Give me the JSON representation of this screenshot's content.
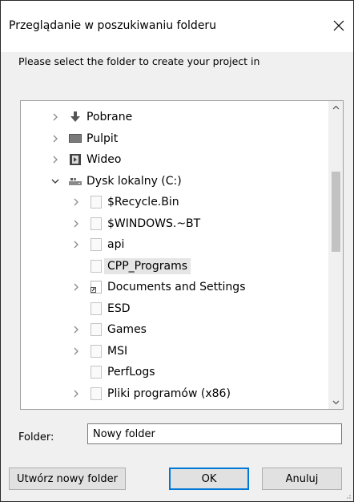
{
  "window": {
    "title": "Przeglądanie w poszukiwaniu folderu",
    "close_icon": "close-icon"
  },
  "instruction": "Please select the folder to create your project in",
  "tree": {
    "items": [
      {
        "label": "Pobrane",
        "icon": "download-arrow-icon",
        "expander": "collapsed",
        "level": 1
      },
      {
        "label": "Pulpit",
        "icon": "desktop-icon",
        "expander": "collapsed",
        "level": 1
      },
      {
        "label": "Wideo",
        "icon": "video-icon",
        "expander": "collapsed",
        "level": 1
      },
      {
        "label": "Dysk lokalny (C:)",
        "icon": "drive-icon",
        "expander": "expanded",
        "level": 1
      },
      {
        "label": "$Recycle.Bin",
        "icon": "folder-icon",
        "expander": "collapsed",
        "level": 2
      },
      {
        "label": "$WINDOWS.~BT",
        "icon": "folder-icon",
        "expander": "collapsed",
        "level": 2
      },
      {
        "label": "api",
        "icon": "folder-icon",
        "expander": "collapsed",
        "level": 2
      },
      {
        "label": "CPP_Programs",
        "icon": "folder-icon",
        "expander": "none",
        "level": 2,
        "selected": true
      },
      {
        "label": "Documents and Settings",
        "icon": "shortcut-folder-icon",
        "expander": "collapsed",
        "level": 2
      },
      {
        "label": "ESD",
        "icon": "folder-icon",
        "expander": "none",
        "level": 2
      },
      {
        "label": "Games",
        "icon": "folder-icon",
        "expander": "collapsed",
        "level": 2
      },
      {
        "label": "MSI",
        "icon": "folder-icon",
        "expander": "collapsed",
        "level": 2
      },
      {
        "label": "PerfLogs",
        "icon": "folder-icon",
        "expander": "none",
        "level": 2
      },
      {
        "label": "Pliki programów (x86)",
        "icon": "folder-icon",
        "expander": "collapsed",
        "level": 2
      }
    ]
  },
  "folder": {
    "label": "Folder:",
    "value": "Nowy folder"
  },
  "buttons": {
    "new_folder": "Utwórz nowy folder",
    "ok": "OK",
    "cancel": "Anuluj"
  },
  "colors": {
    "accent": "#0078d7",
    "selection": "#e5e5e5",
    "dialog_bg": "#f0f0f0"
  }
}
